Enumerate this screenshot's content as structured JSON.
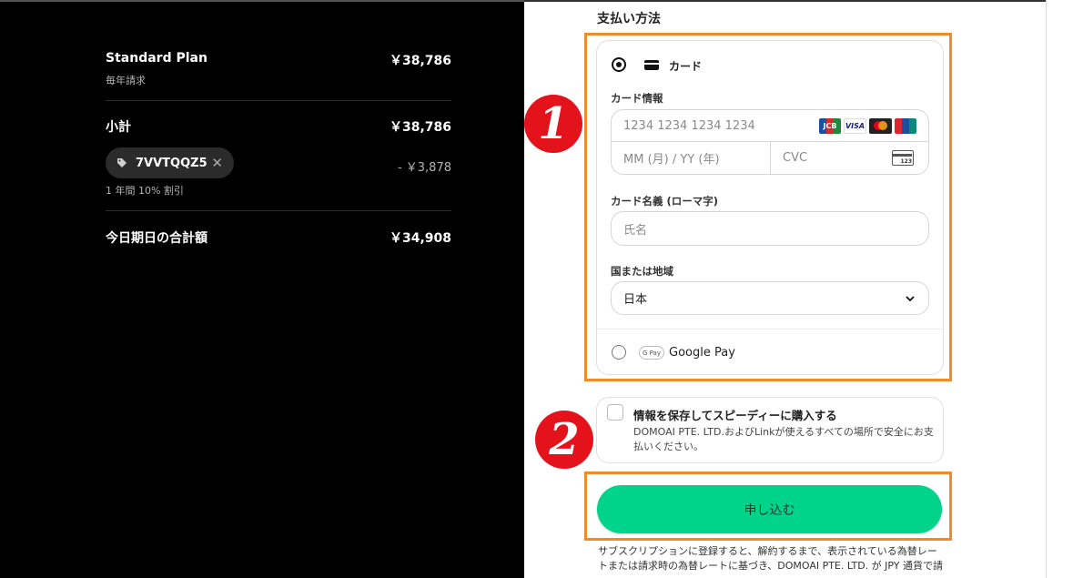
{
  "summary": {
    "plan_name": "Standard Plan",
    "plan_price": "￥38,786",
    "billing_cycle": "毎年請求",
    "subtotal_label": "小計",
    "subtotal_value": "￥38,786",
    "coupon_code": "7VVTQQZ5",
    "coupon_remove": "✕",
    "coupon_discount": "- ￥3,878",
    "coupon_note": "1 年間 10% 割引",
    "total_label": "今日期日の合計額",
    "total_value": "￥34,908"
  },
  "payment": {
    "section_title": "支払い方法",
    "card_option_label": "カード",
    "card_info_label": "カード情報",
    "card_number_placeholder": "1234 1234 1234 1234",
    "expiry_placeholder": "MM (月) / YY (年)",
    "cvc_placeholder": "CVC",
    "cvc_icon_text": "123",
    "card_brands": [
      "JCB",
      "VISA",
      "Mastercard",
      "UnionPay"
    ],
    "cardholder_label": "カード名義 (ローマ字)",
    "cardholder_placeholder": "氏名",
    "country_label": "国または地域",
    "country_value": "日本",
    "gpay_logo_text": "G Pay",
    "gpay_label": "Google Pay"
  },
  "save_info": {
    "title": "情報を保存してスピーディーに購入する",
    "description": "DOMOAI PTE. LTD.およびLinkが使えるすべての場所で安全にお支払いください。"
  },
  "submit_label": "申し込む",
  "legal_text": "サブスクリプションに登録すると、解約するまで、表示されている為替レートまたは請求時の為替レートに基づき、DOMOAI PTE. LTD. が JPY 通貨で請",
  "annotations": {
    "badge_1": "1",
    "badge_2": "2"
  },
  "colors": {
    "accent": "#00d48a",
    "highlight": "#f08a2a",
    "badge": "#e3121b"
  }
}
